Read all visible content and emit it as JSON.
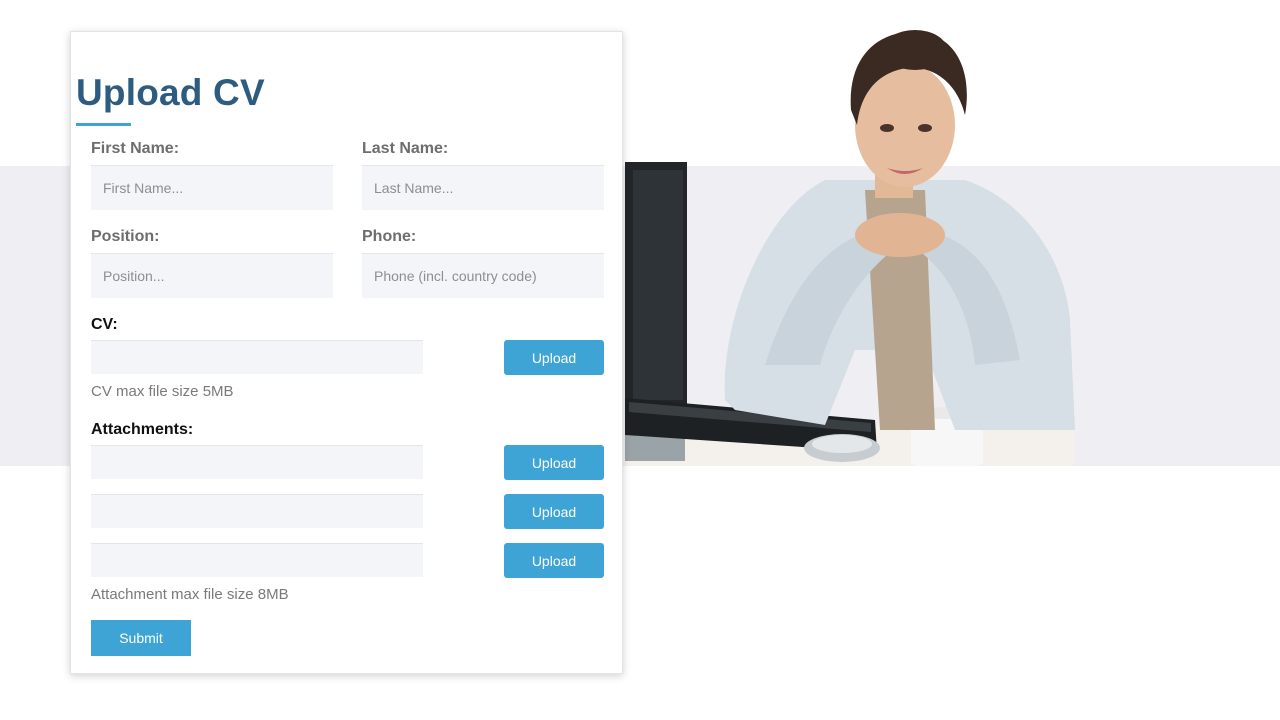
{
  "form": {
    "title": "Upload CV",
    "first_name": {
      "label": "First Name:",
      "placeholder": "First Name..."
    },
    "last_name": {
      "label": "Last Name:",
      "placeholder": "Last Name..."
    },
    "position": {
      "label": "Position:",
      "placeholder": "Position..."
    },
    "phone": {
      "label": "Phone:",
      "placeholder": "Phone (incl. country code)"
    },
    "cv": {
      "label": "CV:",
      "button": "Upload",
      "hint": "CV max file size 5MB"
    },
    "attachments": {
      "label": "Attachments:",
      "buttons": [
        "Upload",
        "Upload",
        "Upload"
      ],
      "hint": "Attachment max file size 8MB"
    },
    "submit_label": "Submit"
  },
  "colors": {
    "accent": "#3ea4d6",
    "title": "#2d5c80",
    "band": "#efeff3",
    "field": "#f3f5f8"
  }
}
